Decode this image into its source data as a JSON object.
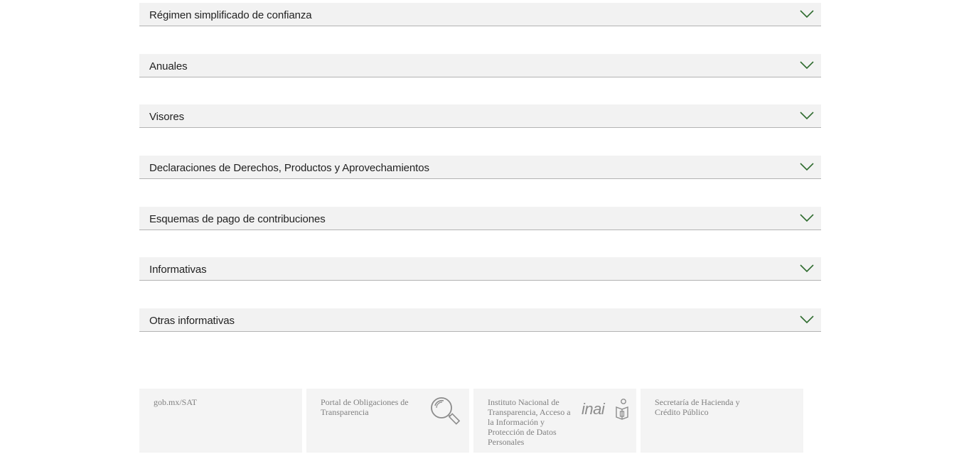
{
  "accordion": {
    "items": [
      {
        "label": "Régimen simplificado de confianza"
      },
      {
        "label": "Anuales"
      },
      {
        "label": "Visores"
      },
      {
        "label": "Declaraciones de Derechos, Productos y Aprovechamientos"
      },
      {
        "label": "Esquemas de pago de contribuciones"
      },
      {
        "label": "Informativas"
      },
      {
        "label": "Otras informativas"
      }
    ],
    "chevron_icon": "chevron-down-icon",
    "chevron_color": "#2e6b2e"
  },
  "footer": {
    "cards": [
      {
        "text": "gob.mx/SAT"
      },
      {
        "text": "Portal de Obligaciones de Transparencia",
        "icon": "magnifier-icon"
      },
      {
        "text": "Instituto Nacional de Transparencia, Acceso a la Información y Protección de Datos Personales",
        "logo": "inai-logo",
        "logo_text": "inai"
      },
      {
        "text": "Secretaría de Hacienda y Crédito Público"
      }
    ]
  }
}
